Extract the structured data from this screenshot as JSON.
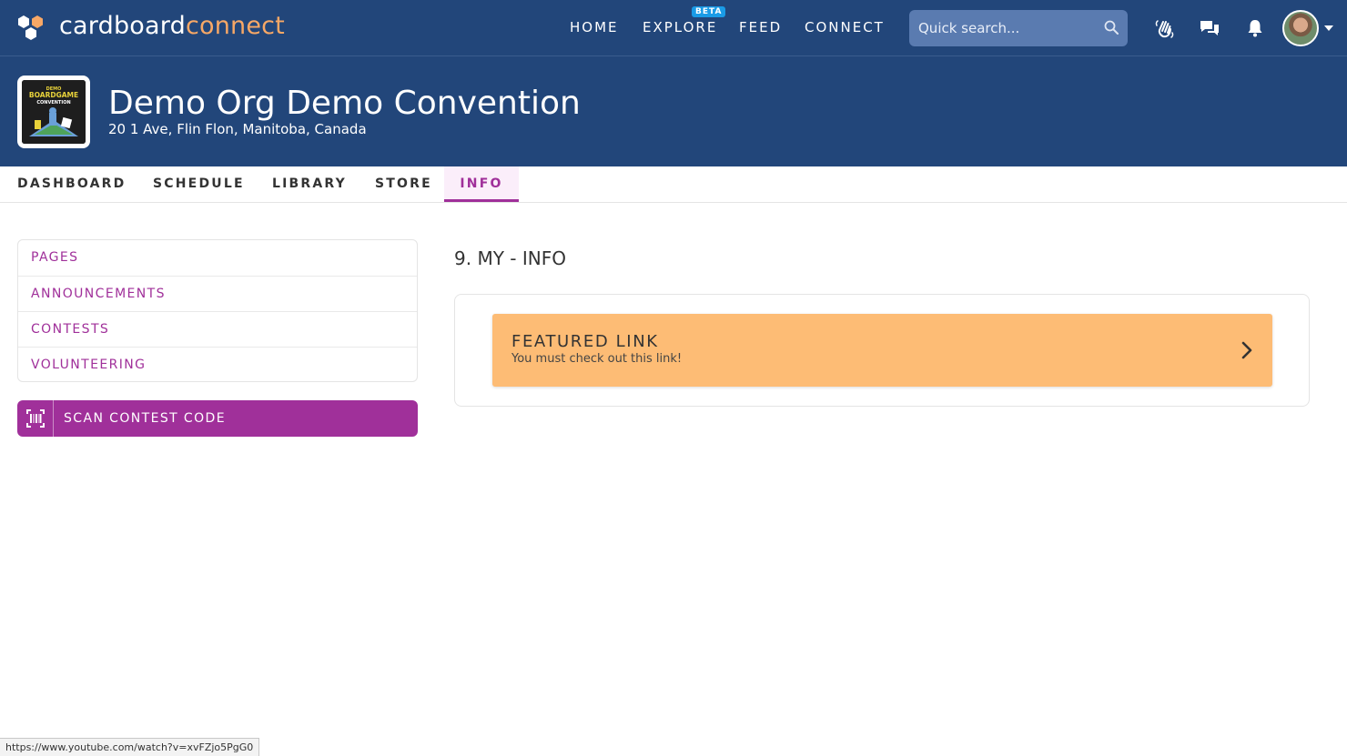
{
  "brand": {
    "part1": "cardboard",
    "part2": "connect"
  },
  "nav": {
    "home": "HOME",
    "explore": "EXPLORE",
    "explore_badge": "BETA",
    "feed": "FEED",
    "connect": "CONNECT"
  },
  "search": {
    "placeholder": "Quick search..."
  },
  "icons": {
    "wave": "hand-wave-icon",
    "messages": "chat-bubbles-icon",
    "notifications": "bell-icon",
    "search": "magnifier-icon"
  },
  "convention": {
    "title": "Demo Org Demo Convention",
    "address": "20 1 Ave, Flin Flon, Manitoba, Canada",
    "logo_text_top": "DEMO",
    "logo_text_main": "BOARDGAME",
    "logo_text_sub": "CONVENTION"
  },
  "tabs": [
    {
      "label": "DASHBOARD"
    },
    {
      "label": "SCHEDULE"
    },
    {
      "label": "LIBRARY"
    },
    {
      "label": "STORE"
    },
    {
      "label": "INFO",
      "active": true
    }
  ],
  "sidebar": {
    "items": [
      {
        "label": "PAGES"
      },
      {
        "label": "ANNOUNCEMENTS"
      },
      {
        "label": "CONTESTS"
      },
      {
        "label": "VOLUNTEERING"
      }
    ],
    "scan_button": "SCAN CONTEST CODE"
  },
  "main": {
    "heading": "9. MY - INFO",
    "featured_link": {
      "title": "FEATURED LINK",
      "subtitle": "You must check out this link!"
    }
  },
  "status_url": "https://www.youtube.com/watch?v=xvFZjo5PgG0",
  "colors": {
    "header_bg": "#22467a",
    "accent": "#a0309a",
    "brand_orange": "#f8a866",
    "featured_bg": "#fdbc75",
    "beta_badge": "#1a9be6"
  }
}
